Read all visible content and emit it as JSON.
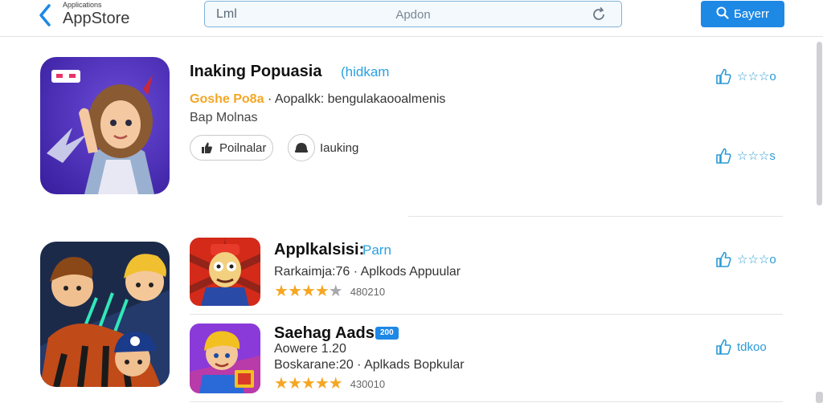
{
  "header": {
    "back_sub": "Applications",
    "back_title": "AppStore",
    "search_left": "Lml",
    "search_value": "Apdon",
    "primary_button": "Бayerr"
  },
  "featured": {
    "title": "Inaking Popuasia",
    "title_tag": "(hidkam",
    "publisher": "Goshe Po8a",
    "subtitle": "· Aopalkk: bengulakaooalmenis",
    "developer": "Bap Molnas",
    "chip_label": "Poilnalar",
    "chip2_label": "Iauking",
    "rate_top": "☆☆☆o",
    "rate_bottom": "☆☆☆s"
  },
  "list": [
    {
      "title": "Applkalsisi:",
      "tag": "Parn",
      "line1": "Rarkaimja:76 · Aplkods Appuular",
      "rating": 4,
      "count": "480210",
      "rate_label": "☆☆☆o"
    },
    {
      "title": "Saehag Aadsr",
      "badge": "200",
      "line0": "Aowere 1.20",
      "line1": "Boskarane:20 · Aplkads Bopkular",
      "rating": 5,
      "count": "430010",
      "rate_label": "tdkoo"
    }
  ],
  "colors": {
    "accent": "#1e88e5",
    "link": "#2b9bd6",
    "star": "#f5a623",
    "divider": "#e3e3e8"
  },
  "icons": [
    "chevron-left-icon",
    "reload-icon",
    "search-icon",
    "thumbs-up-icon",
    "like-icon",
    "cap-icon",
    "star-icon"
  ]
}
